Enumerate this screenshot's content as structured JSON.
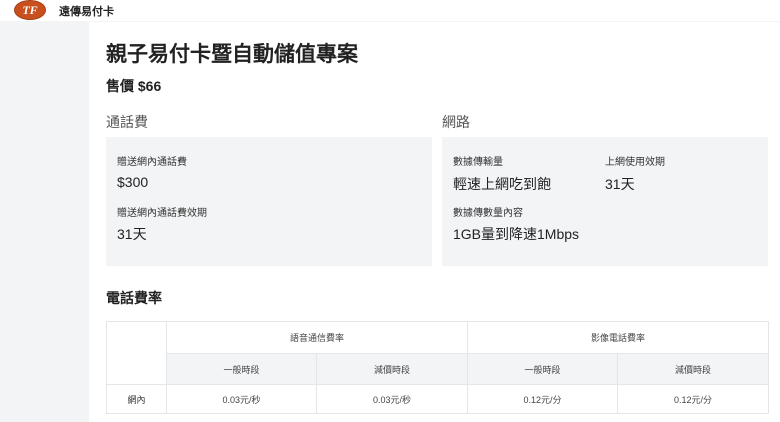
{
  "app": {
    "logo_text": "TF",
    "name": "遠傳易付卡"
  },
  "product": {
    "title": "親子易付卡暨自動儲值專案",
    "price": "售價 $66"
  },
  "call_fee": {
    "section_title": "通話費",
    "items": [
      {
        "label": "贈送網內通話費",
        "value": "$300"
      },
      {
        "label": "贈送網內通話費效期",
        "value": "31天"
      }
    ]
  },
  "network": {
    "section_title": "網路",
    "items": [
      {
        "label": "數據傳輸量",
        "value": "輕速上網吃到飽"
      },
      {
        "label": "上網使用效期",
        "value": "31天"
      },
      {
        "label": "數據傳數量內容",
        "value": "1GB量到降速1Mbps"
      }
    ]
  },
  "rates": {
    "title": "電話費率",
    "groups": [
      "語音通信費率",
      "影像電話費率"
    ],
    "sub_headers": [
      "一般時段",
      "減價時段",
      "一般時段",
      "減價時段"
    ],
    "rows": [
      {
        "name": "網內",
        "values": [
          "0.03元/秒",
          "0.03元/秒",
          "0.12元/分",
          "0.12元/分"
        ]
      }
    ]
  }
}
